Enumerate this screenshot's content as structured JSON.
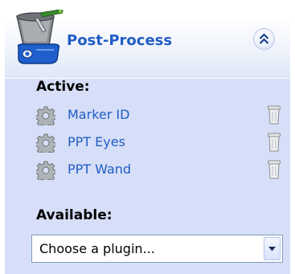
{
  "panel": {
    "title": "Post-Process",
    "title_color": "#215dc6",
    "header_icon": "camera-robot-icon",
    "collapse_icon": "double-chevron-up-icon"
  },
  "active": {
    "label": "Active:",
    "plugins": [
      {
        "name": "Marker ID",
        "icon": "gear-icon",
        "remove_icon": "trash-icon"
      },
      {
        "name": "PPT Eyes",
        "icon": "gear-icon",
        "remove_icon": "trash-icon"
      },
      {
        "name": "PPT Wand",
        "icon": "gear-icon",
        "remove_icon": "trash-icon"
      }
    ]
  },
  "available": {
    "label": "Available:",
    "select_value": "Choose a plugin...",
    "arrow_icon": "dropdown-arrow-icon"
  },
  "colors": {
    "body_bg": "#d6dff7",
    "link": "#215dc6"
  }
}
